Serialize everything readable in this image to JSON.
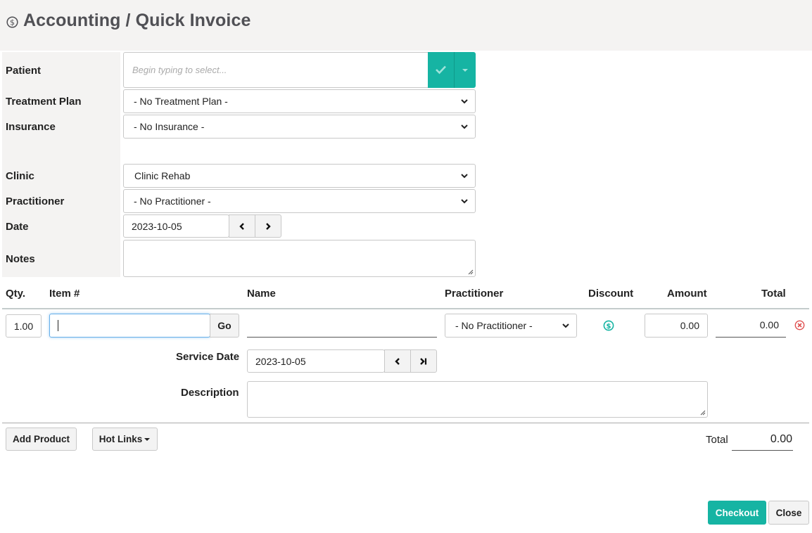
{
  "header": {
    "title": "Accounting / Quick Invoice",
    "icon": "dollar-circle-icon"
  },
  "form": {
    "patient": {
      "label": "Patient",
      "placeholder": "Begin typing to select..."
    },
    "treatment_plan": {
      "label": "Treatment Plan",
      "value": "- No Treatment Plan -"
    },
    "insurance": {
      "label": "Insurance",
      "value": "- No Insurance -"
    },
    "clinic": {
      "label": "Clinic",
      "value": "Clinic Rehab"
    },
    "practitioner": {
      "label": "Practitioner",
      "value": "- No Practitioner -"
    },
    "date": {
      "label": "Date",
      "value": "2023-10-05"
    },
    "notes": {
      "label": "Notes",
      "value": ""
    }
  },
  "table": {
    "headers": {
      "qty": "Qty.",
      "item": "Item #",
      "name": "Name",
      "practitioner": "Practitioner",
      "discount": "Discount",
      "amount": "Amount",
      "total": "Total"
    },
    "row": {
      "qty": "1.00",
      "item": "",
      "go_label": "Go",
      "name": "",
      "practitioner": "- No Practitioner -",
      "amount": "0.00",
      "total": "0.00",
      "service_date_label": "Service Date",
      "service_date": "2023-10-05",
      "description_label": "Description",
      "description": ""
    }
  },
  "footer": {
    "add_product": "Add Product",
    "hot_links": "Hot Links",
    "total_label": "Total",
    "total_value": "0.00",
    "checkout": "Checkout",
    "close": "Close"
  },
  "colors": {
    "accent": "#16b4a3",
    "remove": "#e05050",
    "panel": "#f4f3f2"
  }
}
